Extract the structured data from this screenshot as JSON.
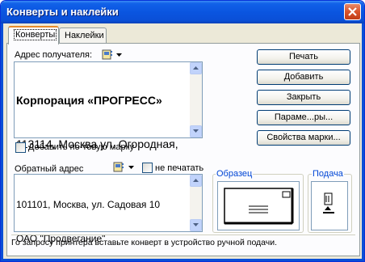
{
  "window": {
    "title": "Конверты и наклейки"
  },
  "tabs": [
    {
      "label": "Конверты",
      "active": true
    },
    {
      "label": "Наклейки",
      "active": false
    }
  ],
  "recipient": {
    "label": "Адрес получателя:",
    "line1": "Корпорация «ПРОГРЕСС»",
    "line2": "113114, Москва ул. Огородная,"
  },
  "add_postage": {
    "label": "Добавить по-товую марку",
    "checked": false
  },
  "return_address": {
    "label": "Обратный адрес",
    "omit_label": "не печатать",
    "omit_checked": false,
    "line1": "101101, Москва, ул. Садовая 10",
    "line2": "ОАО \"Продвегание\""
  },
  "buttons": {
    "print": "Печать",
    "add": "Добавить",
    "close": "Закрыть",
    "options": "Параме...ры...",
    "postage_props": "Свойства марки..."
  },
  "preview": {
    "title": "Образец"
  },
  "feed": {
    "title": "Подача"
  },
  "status": "Го запросу принтера вставьте конверт в устройство ручной подачи.",
  "icons": [
    "address-book-icon",
    "dropdown-arrow-icon",
    "close-icon",
    "scroll-up-icon",
    "scroll-down-icon",
    "envelope-icon",
    "feed-icon"
  ],
  "colors": {
    "titlebar": "#0a4fd6",
    "dialog_bg": "#ece9d8",
    "group_title": "#0046d5"
  }
}
